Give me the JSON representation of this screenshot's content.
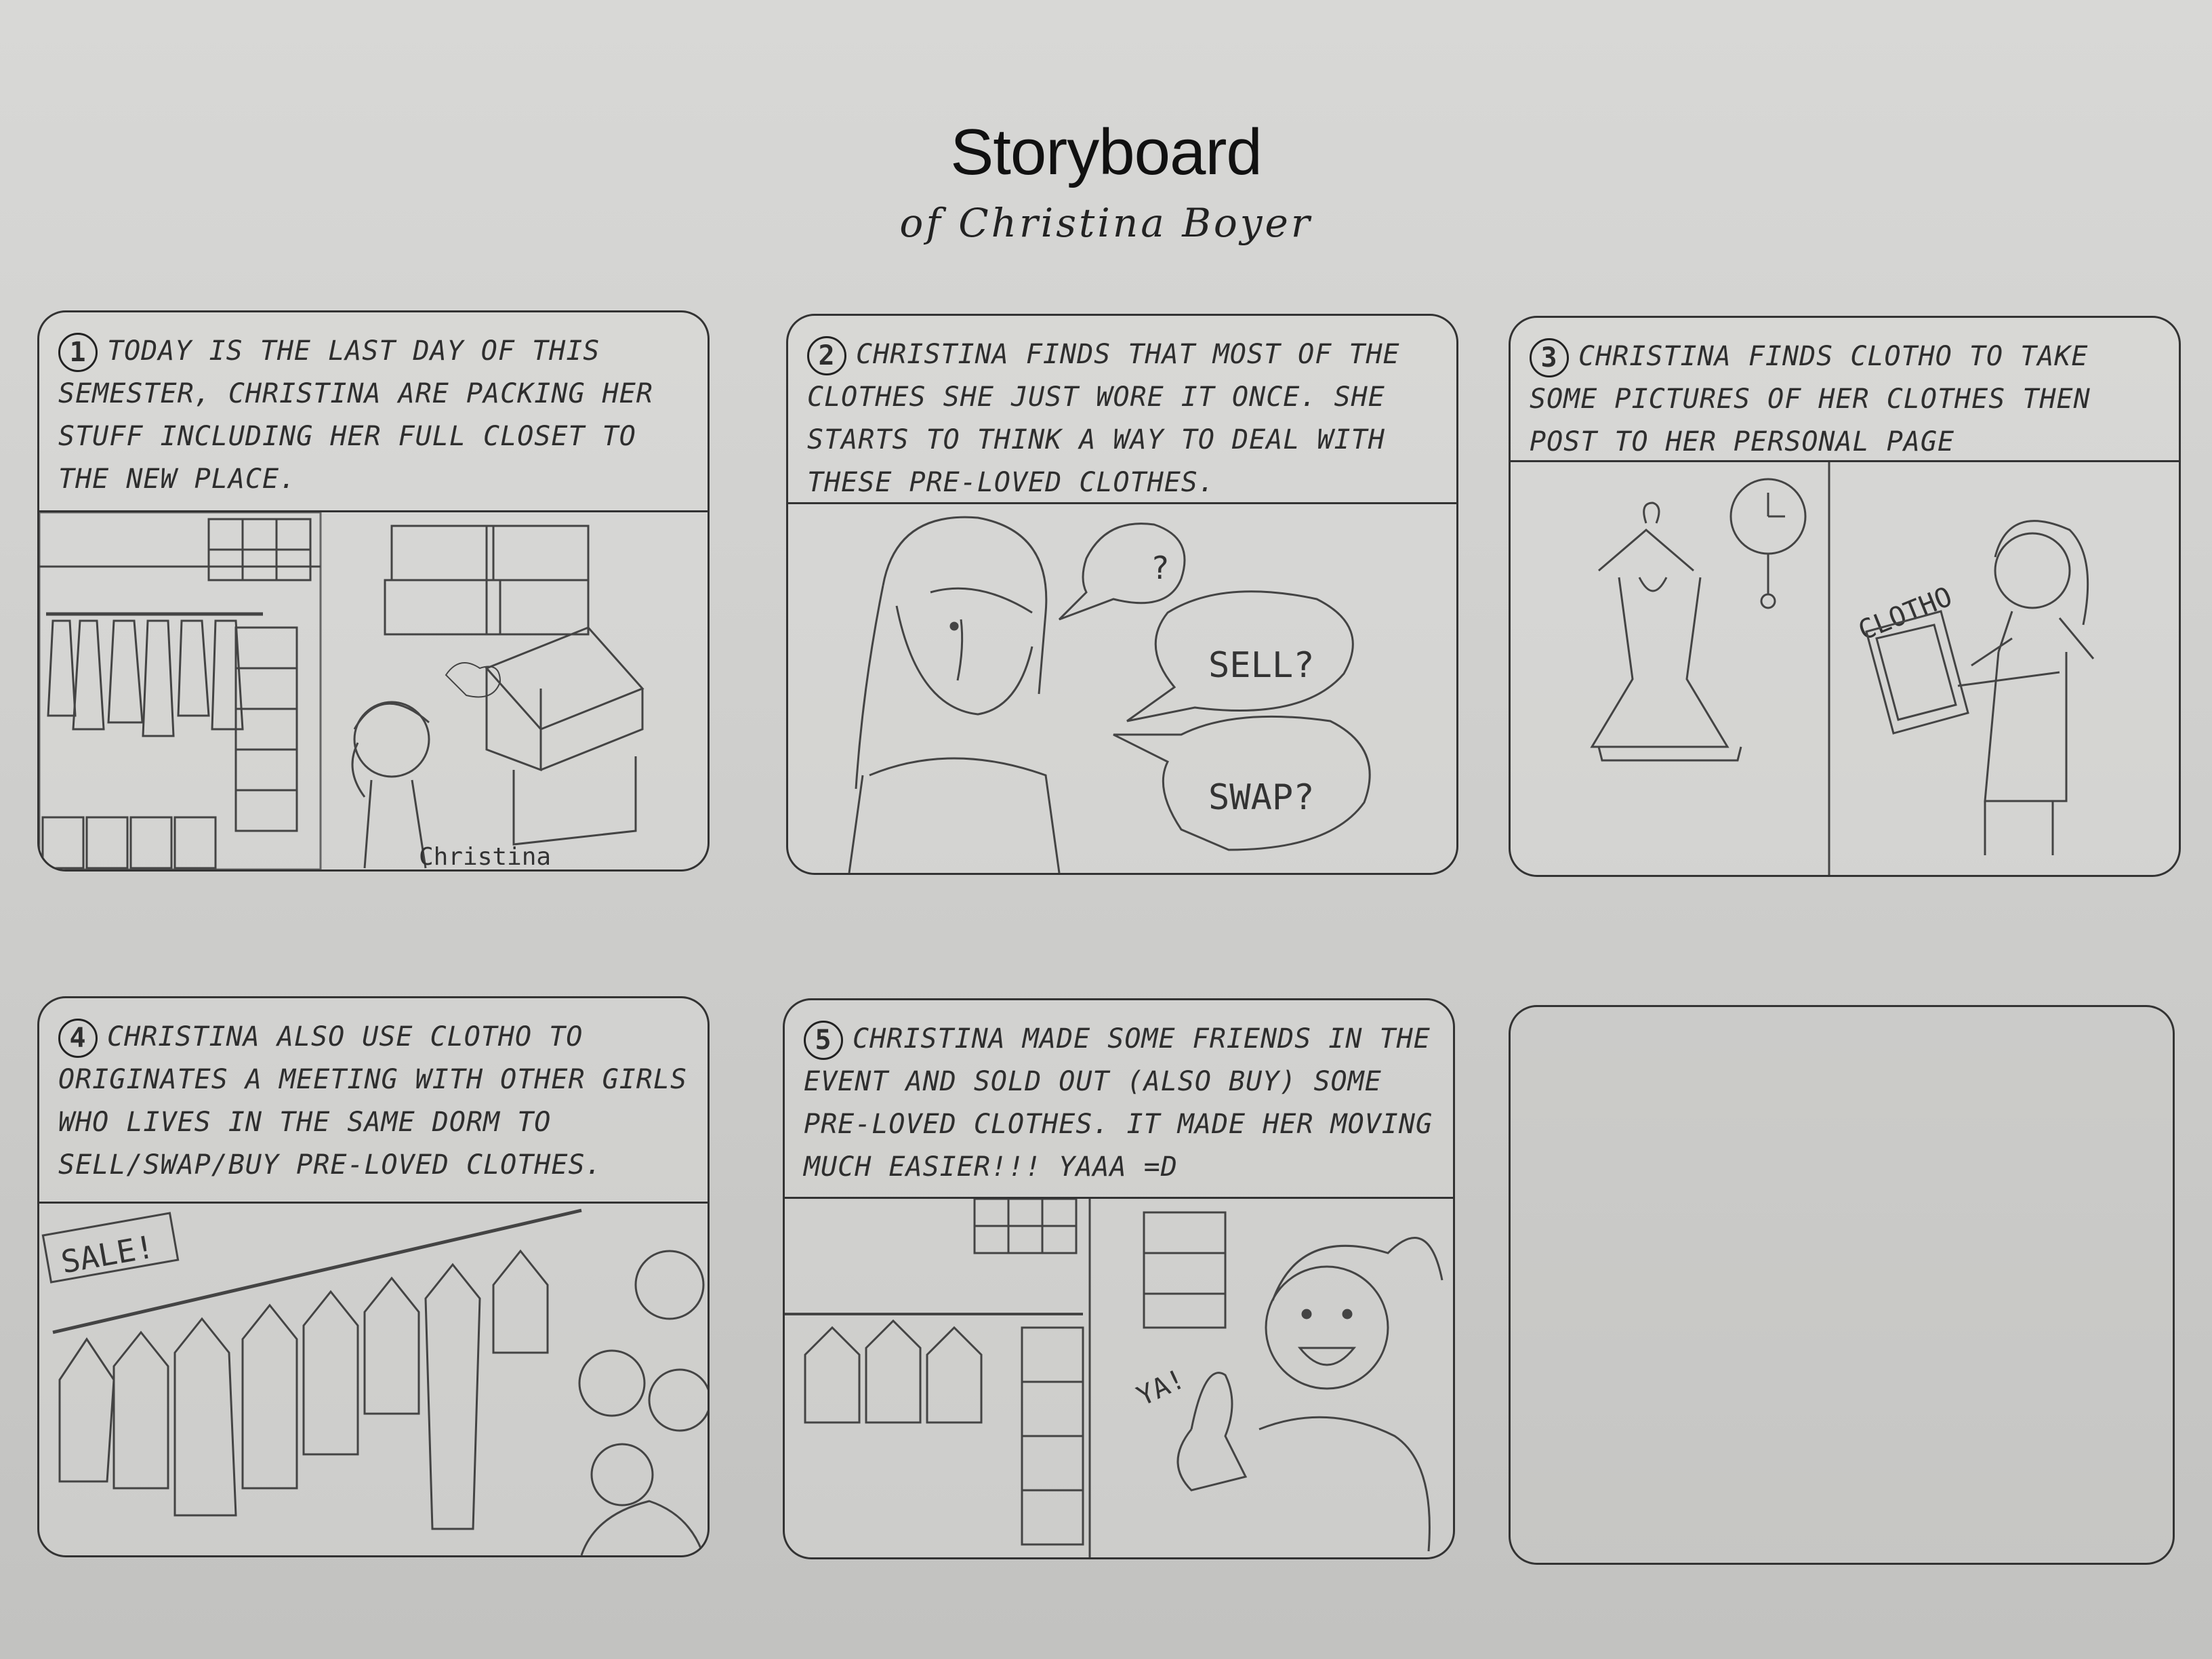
{
  "title": "Storyboard",
  "subtitle": "of Christina Boyer",
  "panels": [
    {
      "number": "1",
      "caption": "TODAY IS THE LAST DAY OF THIS SEMESTER, CHRISTINA ARE PACKING HER STUFF INCLUDING HER FULL CLOSET TO THE NEW PLACE.",
      "label": "Christina"
    },
    {
      "number": "2",
      "caption": "CHRISTINA FINDS THAT MOST OF THE CLOTHES SHE JUST WORE IT ONCE. SHE STARTS TO THINK A WAY TO DEAL WITH THESE PRE-LOVED CLOTHES.",
      "bubbles": [
        "?",
        "SELL?",
        "SWAP?"
      ]
    },
    {
      "number": "3",
      "caption": "CHRISTINA FINDS CLOTHO TO TAKE SOME PICTURES OF HER CLOTHES THEN POST TO HER PERSONAL PAGE",
      "label": "CLOTHO"
    },
    {
      "number": "4",
      "caption": "CHRISTINA ALSO USE CLOTHO TO ORIGINATES A MEETING WITH OTHER GIRLS WHO LIVES IN THE SAME DORM TO SELL/SWAP/BUY PRE-LOVED CLOTHES.",
      "sign": "SALE!"
    },
    {
      "number": "5",
      "caption": "CHRISTINA MADE SOME FRIENDS IN THE EVENT AND SOLD OUT (ALSO BUY) SOME PRE-LOVED CLOTHES. IT MADE HER MOVING MUCH EASIER!!! YAAA =D",
      "exclaim": "YA!"
    },
    {
      "number": "",
      "caption": ""
    }
  ]
}
